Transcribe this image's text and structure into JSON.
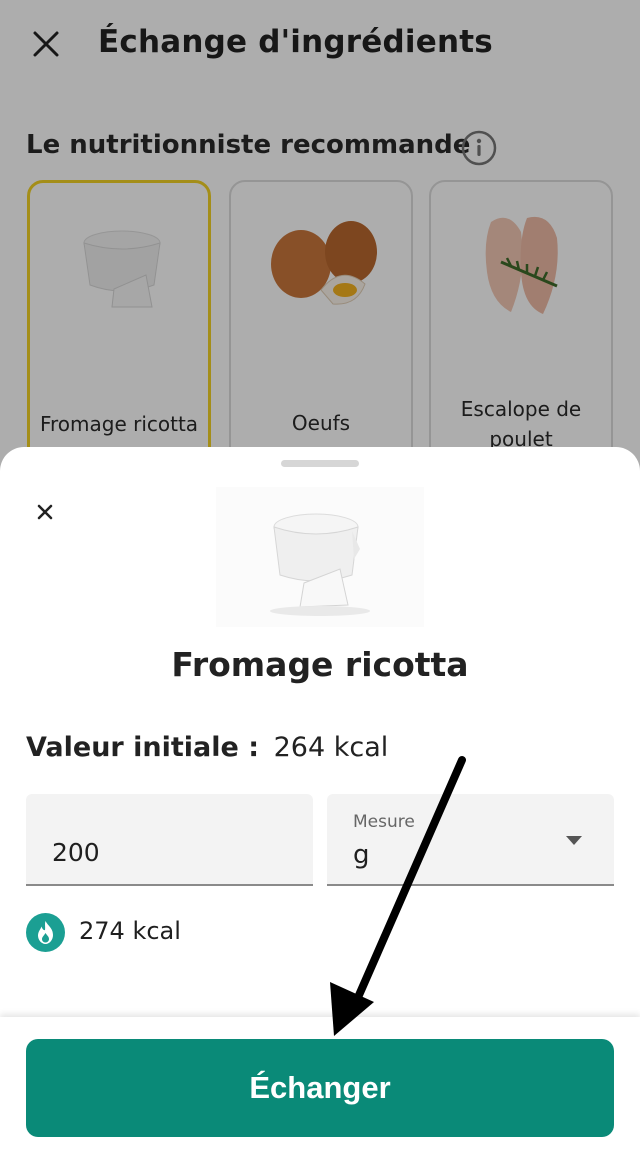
{
  "header": {
    "title": "Échange d'ingrédients"
  },
  "recommendations": {
    "section_title": "Le nutritionniste recommande",
    "items": [
      {
        "label": "Fromage ricotta"
      },
      {
        "label": "Oeufs"
      },
      {
        "label": "Escalope de poulet"
      }
    ]
  },
  "sheet": {
    "food_name": "Fromage ricotta",
    "initial_label": "Valeur initiale :",
    "initial_value": "264 kcal",
    "quantity_value": "200",
    "measure_label": "Mesure",
    "measure_value": "g",
    "computed_kcal": "274 kcal",
    "swap_button_label": "Échanger"
  },
  "colors": {
    "accent": "#0a8a78",
    "selected_border": "#f2d226",
    "kcal_badge": "#1b9f93"
  },
  "icons": [
    "close-icon",
    "info-icon",
    "flame-icon",
    "chevron-down-icon"
  ]
}
